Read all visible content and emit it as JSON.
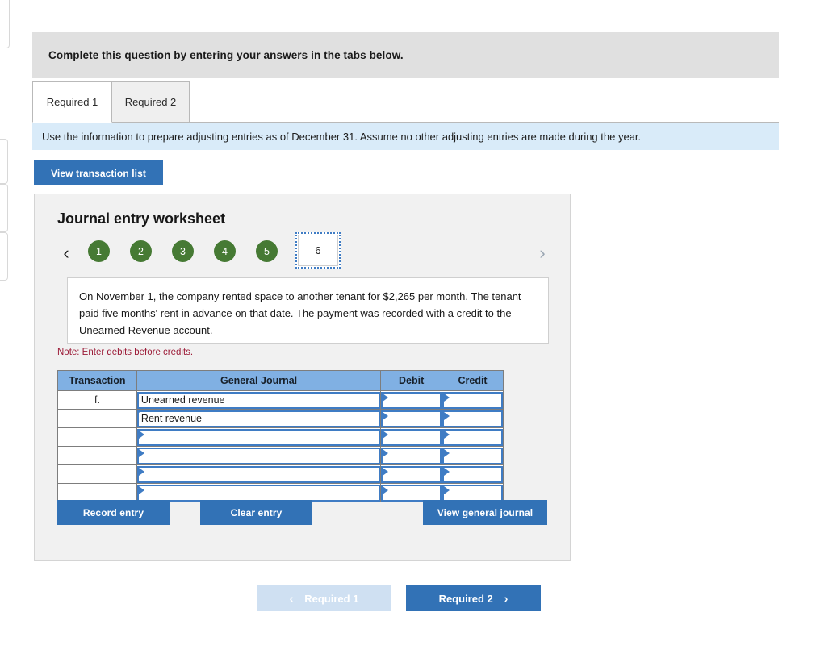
{
  "banner": {
    "text": "Complete this question by entering your answers in the tabs below."
  },
  "tabs": [
    {
      "label": "Required 1",
      "active": true
    },
    {
      "label": "Required 2",
      "active": false
    }
  ],
  "info": {
    "text": "Use the information to prepare adjusting entries as of December 31. Assume no other adjusting entries are made during the year."
  },
  "toolbar": {
    "view_transaction_list": "View transaction list"
  },
  "worksheet": {
    "title": "Journal entry worksheet",
    "prev_arrow": "‹",
    "next_arrow": "›",
    "steps": [
      "1",
      "2",
      "3",
      "4",
      "5"
    ],
    "current_step": "6",
    "prompt": "On November 1, the company rented space to another tenant for $2,265 per month. The tenant paid five months' rent in advance on that date. The payment was recorded with a credit to the Unearned Revenue account.",
    "note": "Note: Enter debits before credits.",
    "table": {
      "headers": [
        "Transaction",
        "General Journal",
        "Debit",
        "Credit"
      ],
      "rows": [
        {
          "transaction": "f.",
          "journal": "Unearned revenue",
          "debit": "",
          "credit": ""
        },
        {
          "transaction": "",
          "journal": "Rent revenue",
          "debit": "",
          "credit": ""
        },
        {
          "transaction": "",
          "journal": "",
          "debit": "",
          "credit": ""
        },
        {
          "transaction": "",
          "journal": "",
          "debit": "",
          "credit": ""
        },
        {
          "transaction": "",
          "journal": "",
          "debit": "",
          "credit": ""
        },
        {
          "transaction": "",
          "journal": "",
          "debit": "",
          "credit": ""
        }
      ]
    },
    "actions": {
      "record_entry": "Record entry",
      "clear_entry": "Clear entry",
      "view_general_journal": "View general journal"
    }
  },
  "footer": {
    "prev_label": "Required 1",
    "prev_arrow": "‹",
    "next_label": "Required 2",
    "next_arrow": "›"
  },
  "colors": {
    "accent_blue": "#3272b6",
    "header_blue": "#80b0e3",
    "info_blue": "#d9ebf9",
    "step_green": "#467a34",
    "note_red": "#9c1c38",
    "banner_gray": "#e0e0e0",
    "panel_gray": "#f1f1f1"
  }
}
